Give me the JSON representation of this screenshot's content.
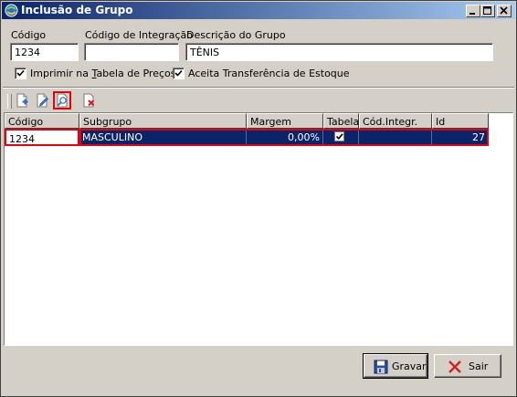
{
  "window": {
    "title": "Inclusão de Grupo",
    "controls": [
      "minimize-icon",
      "maximize-icon",
      "close-icon"
    ]
  },
  "form": {
    "codigo_label": "Código",
    "codigo_value": "1234",
    "integracao_label": "Código de Integração",
    "integracao_value": "",
    "descricao_label": "Descrição do Grupo",
    "descricao_value": "TÊNIS",
    "imprimir_pre": "Imprimir na ",
    "imprimir_accel": "T",
    "imprimir_post": "abela de Preços",
    "imprimir_checked": true,
    "transferencia_label": "Aceita Transferência de Estoque",
    "transferencia_checked": true
  },
  "toolbar": {
    "items": [
      "add-icon",
      "edit-icon",
      "search-icon",
      "delete-icon"
    ],
    "selected": "search-icon"
  },
  "grid": {
    "headers": [
      "Código",
      "Subgrupo",
      "Margem",
      "Tabela",
      "Cód.Integr.",
      "Id"
    ],
    "rows": [
      {
        "codigo": "1234",
        "subgrupo": "MASCULINO",
        "margem": "0,00%",
        "tabela": true,
        "cod_integr": "",
        "id": "27"
      }
    ]
  },
  "buttons": {
    "gravar": "Gravar",
    "sair": "Sair"
  },
  "colors": {
    "title_start": "#0a246a",
    "title_end": "#a6caf0",
    "selection": "#0a246a",
    "highlight": "#e8000d",
    "face": "#d4d0c8"
  }
}
